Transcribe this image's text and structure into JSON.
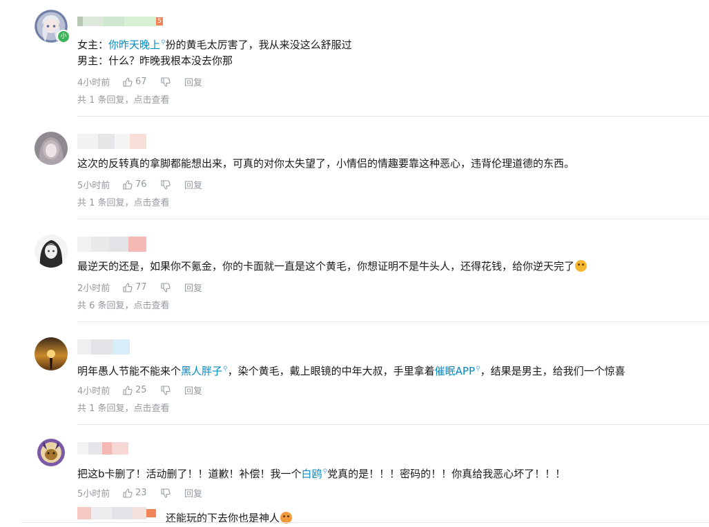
{
  "comments": [
    {
      "text_parts": [
        "女主：",
        "你昨天晚上",
        "扮的黄毛太厉害了，我从来没这么舒服过"
      ],
      "text2": "男主：什么？昨晚我根本没去你那",
      "time": "4小时前",
      "likes": "67",
      "reply_label": "回复",
      "replies_summary": "共 1 条回复，点击查看",
      "level_badge": "5",
      "avatar_badge": "小"
    },
    {
      "text": "这次的反转真的拿脚都能想出来，可真的对你太失望了，小情侣的情趣要靠这种恶心，违背伦理道德的东西。",
      "time": "5小时前",
      "likes": "76",
      "reply_label": "回复",
      "replies_summary": "共 1 条回复，点击查看"
    },
    {
      "text": "最逆天的还是，如果你不氪金，你的卡面就一直是这个黄毛，你想证明不是牛头人，还得花钱，给你逆天完了",
      "time": "2小时前",
      "likes": "77",
      "reply_label": "回复",
      "replies_summary": "共 6 条回复，点击查看"
    },
    {
      "text_parts": [
        "明年愚人节能不能来个",
        "黑人胖子",
        "，染个黄毛，戴上眼镜的中年大叔，手里拿着",
        "催眠APP",
        "，结果是男主，给我们一个惊喜"
      ],
      "time": "4小时前",
      "likes": "25",
      "reply_label": "回复",
      "replies_summary": "共 1 条回复，点击查看"
    },
    {
      "text_parts": [
        "把这b卡删了！活动删了！！道歉！补偿！我一个",
        "白鸥",
        "党真的是！！！密码的！！你真给我恶心坏了！！！"
      ],
      "time": "5小时前",
      "likes": "23",
      "reply_label": "回复"
    },
    {
      "text": "还能玩的下去你也是神人"
    }
  ],
  "colors": {
    "link": "#008ac5",
    "meta": "#9499a0",
    "divider": "#e3e5e7",
    "level_badge": "#f0835a"
  },
  "icons": [
    "thumb-up-icon",
    "thumb-down-icon",
    "search-keyword-icon",
    "emoji-laugh-icon"
  ]
}
